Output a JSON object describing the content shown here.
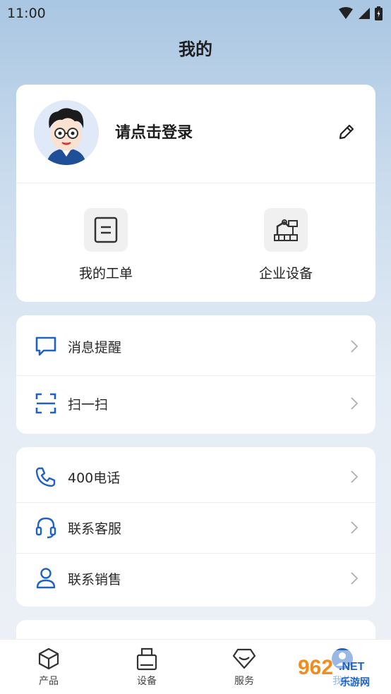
{
  "status_bar": {
    "time": "11:00"
  },
  "page_title": "我的",
  "profile": {
    "login_text": "请点击登录",
    "quick_actions": [
      {
        "label": "我的工单",
        "icon": "work-order-icon"
      },
      {
        "label": "企业设备",
        "icon": "enterprise-equipment-icon"
      }
    ]
  },
  "menu_group_1": [
    {
      "label": "消息提醒",
      "icon": "message-icon"
    },
    {
      "label": "扫一扫",
      "icon": "scan-icon"
    }
  ],
  "menu_group_2": [
    {
      "label": "400电话",
      "icon": "phone-icon"
    },
    {
      "label": "联系客服",
      "icon": "headset-icon"
    },
    {
      "label": "联系销售",
      "icon": "user-icon"
    }
  ],
  "tabbar": {
    "tabs": [
      {
        "label": "产品",
        "icon": "cube-icon"
      },
      {
        "label": "设备",
        "icon": "device-icon"
      },
      {
        "label": "服务",
        "icon": "diamond-icon"
      },
      {
        "label": "我的",
        "icon": "profile-icon"
      }
    ]
  },
  "watermark": {
    "text": "962.NET",
    "subtext": "乐游网"
  },
  "colors": {
    "accent": "#1e62c4",
    "card": "#ffffff"
  }
}
